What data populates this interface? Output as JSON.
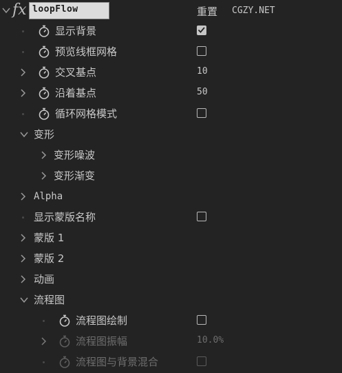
{
  "effect": {
    "fx_symbol": "fx",
    "name": "loopFlow",
    "reset_label": "重置",
    "about_label": "CGZY.NET"
  },
  "rows": [
    {
      "label": "显示背景",
      "control": "checkbox",
      "checked": true
    },
    {
      "label": "预览线框网格",
      "control": "checkbox",
      "checked": false
    },
    {
      "label": "交叉基点",
      "value": "10"
    },
    {
      "label": "沿着基点",
      "value": "50"
    },
    {
      "label": "循环网格模式",
      "control": "checkbox",
      "checked": false
    },
    {
      "label": "变形",
      "expanded": true
    },
    {
      "label": "变形噪波",
      "expanded": false
    },
    {
      "label": "变形渐变",
      "expanded": false
    },
    {
      "label": "Alpha",
      "expanded": false
    },
    {
      "label": "显示蒙版名称",
      "control": "checkbox",
      "checked": false
    },
    {
      "label": "蒙版 1",
      "expanded": false
    },
    {
      "label": "蒙版 2",
      "expanded": false
    },
    {
      "label": "动画",
      "expanded": false
    },
    {
      "label": "流程图",
      "expanded": true
    },
    {
      "label": "流程图绘制",
      "control": "checkbox",
      "checked": false
    },
    {
      "label": "流程图振幅",
      "value": "10.0%",
      "disabled": true
    },
    {
      "label": "流程图与背景混合",
      "control": "checkbox",
      "checked": false,
      "disabled": true
    }
  ],
  "colors": {
    "background": "#232323",
    "text": "#c8c8c8",
    "disabled_text": "#6e6e6e",
    "name_box": "#dcdcdc"
  }
}
